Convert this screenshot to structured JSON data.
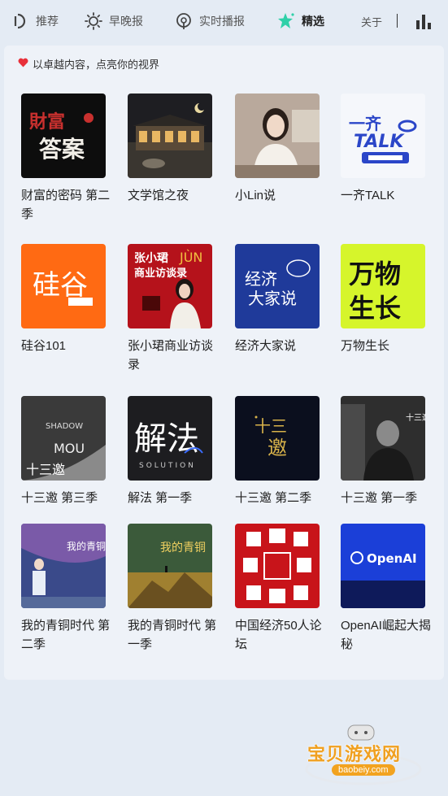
{
  "nav": {
    "tabs": [
      {
        "label": "推荐",
        "icon": "recommend-icon"
      },
      {
        "label": "早晚报",
        "icon": "sun-icon"
      },
      {
        "label": "实时播报",
        "icon": "broadcast-icon"
      },
      {
        "label": "精选",
        "icon": "sparkle-icon",
        "active": true
      }
    ],
    "about_label": "关于",
    "accent": "#2fd0a8"
  },
  "slogan": "以卓越内容，点亮你的视界",
  "podcasts": [
    {
      "title": "财富的密码 第二季",
      "cover_text": "财富的答案",
      "color": "#111111",
      "accent": "#c8302e"
    },
    {
      "title": "文学馆之夜",
      "cover_text": "",
      "color": "#2b2a26",
      "accent": "#d8b070"
    },
    {
      "title": "小Lin说",
      "cover_text": "",
      "color": "#b9a99c",
      "accent": "#f2ece6"
    },
    {
      "title": "一齐TALK",
      "cover_text": "一齐TALK",
      "color": "#f5f7fb",
      "accent": "#2b46c8"
    },
    {
      "title": "硅谷101",
      "cover_text": "硅谷",
      "color": "#ff6a13",
      "accent": "#ffffff"
    },
    {
      "title": "张小珺商业访谈录",
      "cover_text": "张小珺商业访谈录",
      "color": "#b5121b",
      "accent": "#ffffff"
    },
    {
      "title": "经济大家说",
      "cover_text": "经济大家说",
      "color": "#1f3a9a",
      "accent": "#ffffff"
    },
    {
      "title": "万物生长",
      "cover_text": "万物生长",
      "color": "#d6f52b",
      "accent": "#111111"
    },
    {
      "title": "十三邀 第三季",
      "cover_text": "十三邀",
      "color": "#6e6e6e",
      "accent": "#ffffff"
    },
    {
      "title": "解法 第一季",
      "cover_text": "解法",
      "color": "#1d1d20",
      "accent": "#ffffff"
    },
    {
      "title": "十三邀 第二季",
      "cover_text": "十三邀",
      "color": "#0b0f1e",
      "accent": "#d8b24a"
    },
    {
      "title": "十三邀 第一季",
      "cover_text": "十三邀",
      "color": "#2e2e2e",
      "accent": "#ffffff"
    },
    {
      "title": "我的青铜时代 第二季",
      "cover_text": "我的青铜时代",
      "color": "#3a4a8a",
      "accent": "#ffffff"
    },
    {
      "title": "我的青铜时代 第一季",
      "cover_text": "我的青铜时代",
      "color": "#3b5a3a",
      "accent": "#f0d060"
    },
    {
      "title": "中国经济50人论坛",
      "cover_text": "",
      "color": "#c8141a",
      "accent": "#ffffff"
    },
    {
      "title": "OpenAI崛起大揭秘",
      "cover_text": "OpenAI",
      "color": "#1b3fd8",
      "accent": "#ffffff"
    }
  ],
  "watermark": {
    "text": "宝贝游戏网",
    "url": "baobeiy.com"
  }
}
